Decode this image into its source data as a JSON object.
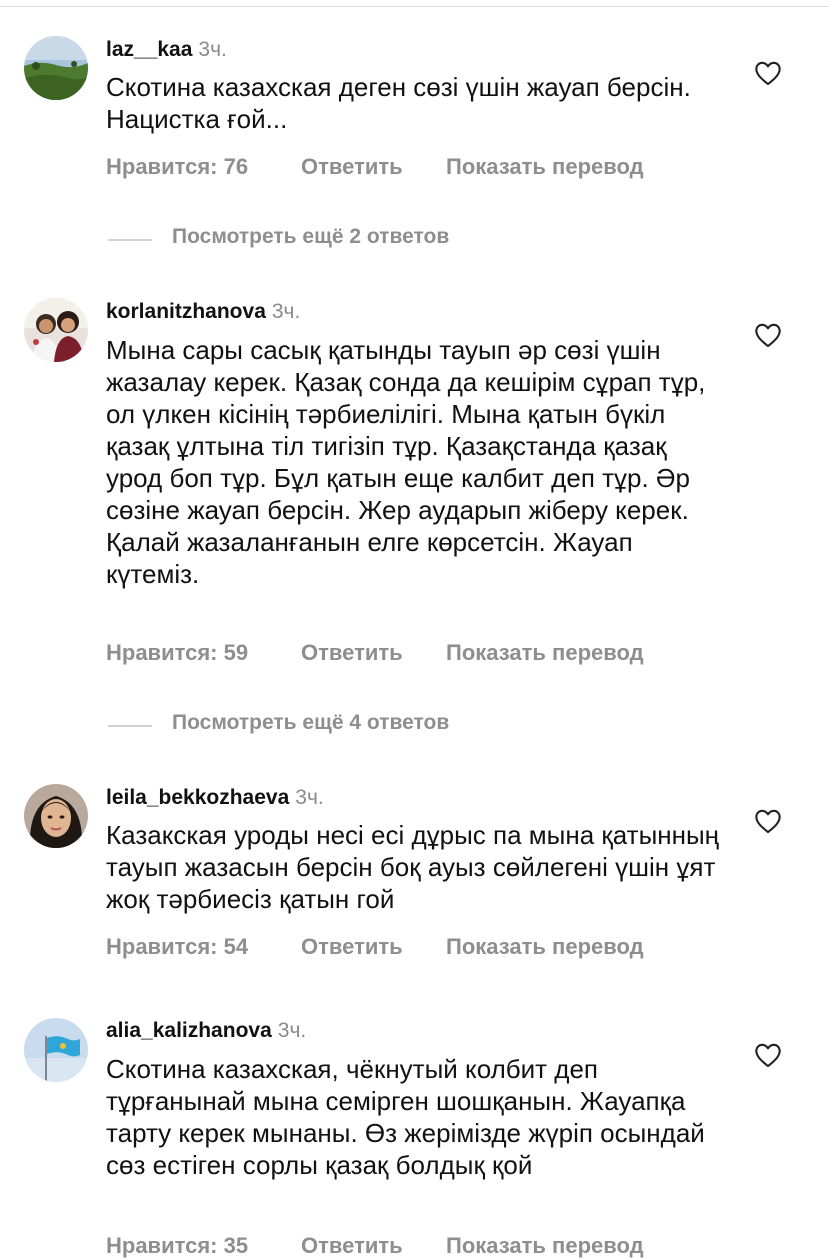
{
  "comments": [
    {
      "username": "laz__kaa",
      "time": "3ч.",
      "text": "Скотина казахская деген сөзі үшін жауап берсін. Нацистка ғой...",
      "likes": "Нравится: 76",
      "reply": "Ответить",
      "translate": "Показать перевод"
    },
    {
      "username": "korlanitzhanova",
      "time": "3ч.",
      "text": "Мына сары сасық қатынды тауып әр сөзі үшін жазалау керек. Қазақ сонда да кешірім сұрап тұр, ол үлкен кісінің тәрбиелілігі. Мына қатын бүкіл қазақ ұлтына тіл тигізіп тұр. Қазақстанда қазақ урод боп тұр. Бұл қатын еще калбит деп тұр. Әр сөзіне жауап берсін. Жер аударып жіберу керек. Қалай жазаланғанын елге көрсетсін. Жауап күтеміз.",
      "likes": "Нравится: 59",
      "reply": "Ответить",
      "translate": "Показать перевод"
    },
    {
      "username": "leila_bekkozhaeva",
      "time": "3ч.",
      "text": "Казакская уроды несі есі дұрыс па мына қатынның тауып жазасын берсін боқ ауыз сөйлегені үшін ұят жоқ тәрбиесіз қатын гой",
      "likes": "Нравится: 54",
      "reply": "Ответить",
      "translate": "Показать перевод"
    },
    {
      "username": "alia_kalizhanova",
      "time": "3ч.",
      "text": "Скотина казахская, чёкнутый колбит  деп тұрғанынай мына семірген шошқанын. Жауапқа тарту керек мынаны. Өз жерімізде жүріп осындай сөз естіген сорлы қазақ болдық қой",
      "likes": "Нравится: 35",
      "reply": "Ответить",
      "translate": "Показать перевод"
    }
  ],
  "reply_threads": [
    {
      "label": "Посмотреть ещё 2 ответов"
    },
    {
      "label": "Посмотреть ещё 4 ответов"
    }
  ],
  "icons": {
    "like": "heart-outline-icon"
  },
  "colors": {
    "text": "#111111",
    "muted": "#8e8e8e",
    "divider": "#d2d2d2"
  }
}
